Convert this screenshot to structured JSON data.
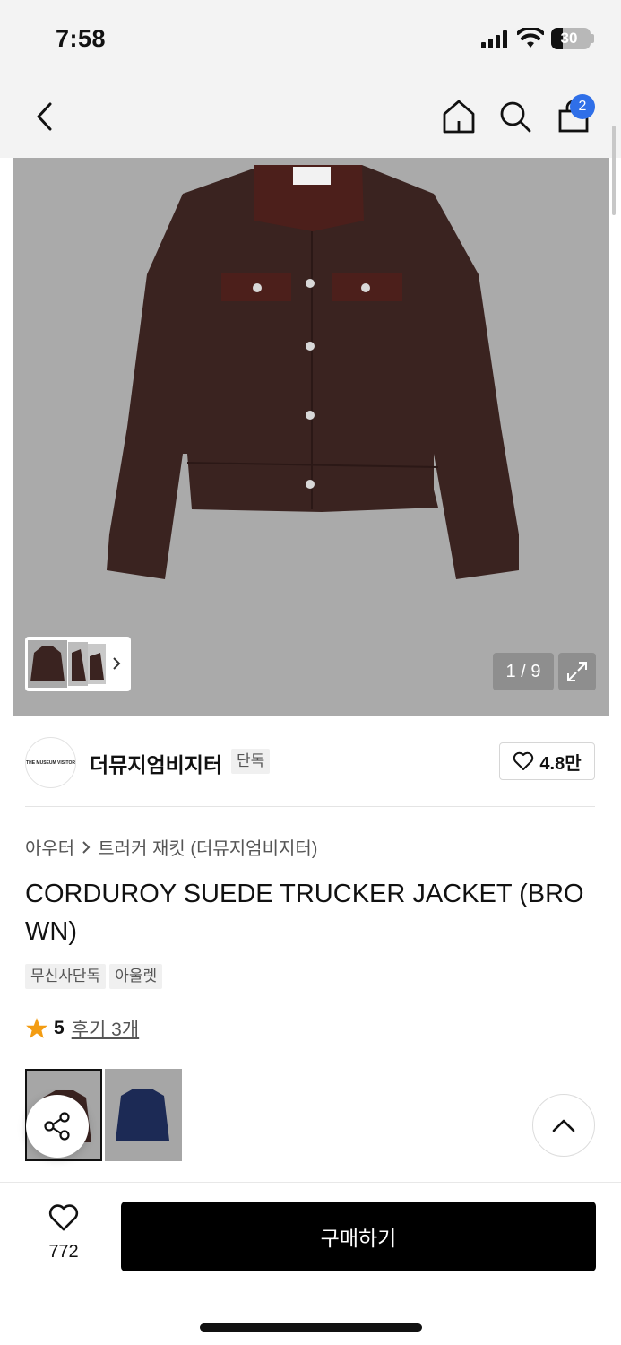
{
  "status_bar": {
    "time": "7:58",
    "battery_percent": "30",
    "battery_level": 0.3
  },
  "nav": {
    "back_icon": "chevron-left-icon",
    "home_icon": "home-icon",
    "search_icon": "search-icon",
    "cart_icon": "shopping-bag-icon",
    "cart_count": "2"
  },
  "gallery": {
    "counter": "1 / 9",
    "expand_icon": "expand-icon",
    "thumbnail_arrow_icon": "chevron-right-icon",
    "image_position": 0.111
  },
  "brand": {
    "logo_text": "THE MUSEUM VISITOR",
    "name": "더뮤지엄비지터",
    "exclusive_tag": "단독",
    "likes": "4.8만"
  },
  "product": {
    "breadcrumb": {
      "category": "아우터",
      "subcategory": "트러커 재킷 (더뮤지엄비지터)"
    },
    "title": "CORDUROY SUEDE TRUCKER JACKET (BROWN)",
    "tags": [
      "무신사단독",
      "아울렛"
    ],
    "rating": {
      "score": "5",
      "reviews": "후기 3개",
      "stars": 5
    },
    "color_options": [
      "brown",
      "navy"
    ]
  },
  "actions": {
    "wish_count": "772",
    "buy_label": "구매하기"
  },
  "colors": {
    "accent": "#2f6fe8",
    "star": "#f39c12",
    "buy_button": "#000000",
    "hero_bg": "#aaaaaa",
    "jacket": "#3a2320",
    "collar": "#4c1f1b"
  }
}
